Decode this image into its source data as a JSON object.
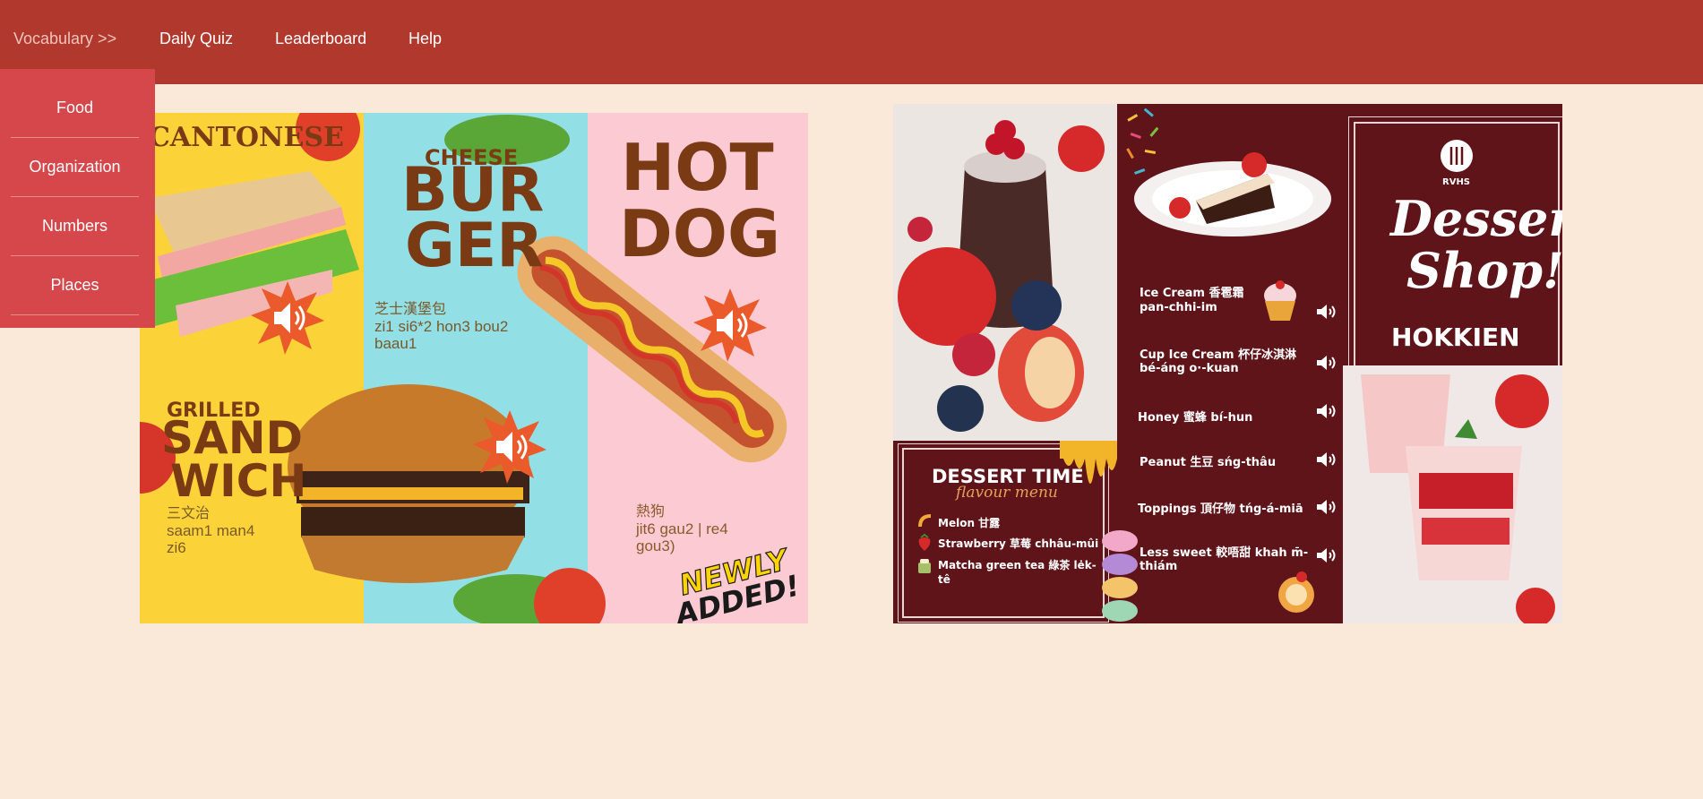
{
  "nav": {
    "vocabulary": "Vocabulary >>",
    "daily_quiz": "Daily Quiz",
    "leaderboard": "Leaderboard",
    "help": "Help"
  },
  "dropdown": {
    "items": [
      "Food",
      "Organization",
      "Numbers",
      "Places"
    ]
  },
  "cantonese_card": {
    "language": "CANTONESE",
    "cheese": "CHEESE",
    "burger_line1": "BUR",
    "burger_line2": "GER",
    "burger_chinese": "芝士漢堡包",
    "burger_roman_1": "zi1 si6*2 hon3 bou2",
    "burger_roman_2": "baau1",
    "hotdog_line1": "HOT",
    "hotdog_line2": "DOG",
    "hotdog_chinese": "熱狗",
    "hotdog_roman_1": "jit6 gau2 | re4",
    "hotdog_roman_2": "gou3)",
    "grilled": "GRILLED",
    "sandwich_line1": "SAND",
    "sandwich_line2": "WICH",
    "sandwich_chinese": "三文治",
    "sandwich_roman_1": "saam1 man4",
    "sandwich_roman_2": "zi6",
    "badge_1": "NEWLY",
    "badge_2": "ADDED!"
  },
  "hokkien_card": {
    "logo": "RVHS",
    "title_1": "Dessert",
    "title_2": "Shop!",
    "language": "HOKKIEN",
    "items": [
      {
        "line1": "Ice Cream 香雹霜",
        "line2": "pan-chhi-im"
      },
      {
        "line1": "Cup Ice Cream 杯仔冰淇淋",
        "line2": "bé-áng o·-kuan"
      },
      {
        "line1": "Honey 蜜蜂 bí-hun",
        "line2": ""
      },
      {
        "line1": "Peanut 生豆 sńg-thâu",
        "line2": ""
      },
      {
        "line1": "Toppings 頂仔物 tńg-á-miā",
        "line2": ""
      },
      {
        "line1": "Less sweet 較唔甜 khah m̄-",
        "line2": "thiám"
      }
    ],
    "dessert_time": "DESSERT TIME",
    "flavour_menu": "flavour menu",
    "flavours": [
      {
        "line1": "Melon 甘露",
        "line2": ""
      },
      {
        "line1": "Strawberry 草莓 chhâu-mûi",
        "line2": ""
      },
      {
        "line1": "Matcha green tea 綠茶 lėk-",
        "line2": "tê"
      }
    ]
  },
  "colors": {
    "nav_bg": "#b1382d",
    "dropdown_bg": "#d5474a",
    "page_bg": "#fae8d9",
    "maroon": "#5e1419"
  }
}
